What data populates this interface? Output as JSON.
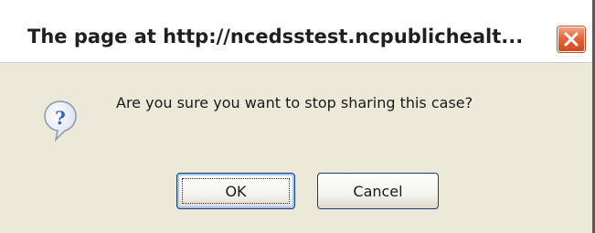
{
  "dialog": {
    "title": "The page at http://ncedsstest.ncpublichealt...",
    "message": "Are you sure you want to stop sharing this case?",
    "icon": "question-icon",
    "buttons": {
      "ok_label": "OK",
      "cancel_label": "Cancel"
    },
    "close_icon": "close-icon"
  },
  "colors": {
    "dialog_background": "#ece9d8",
    "close_button": "#e2663c",
    "button_border": "#1c3e7a",
    "icon_blue": "#2f64c8"
  }
}
